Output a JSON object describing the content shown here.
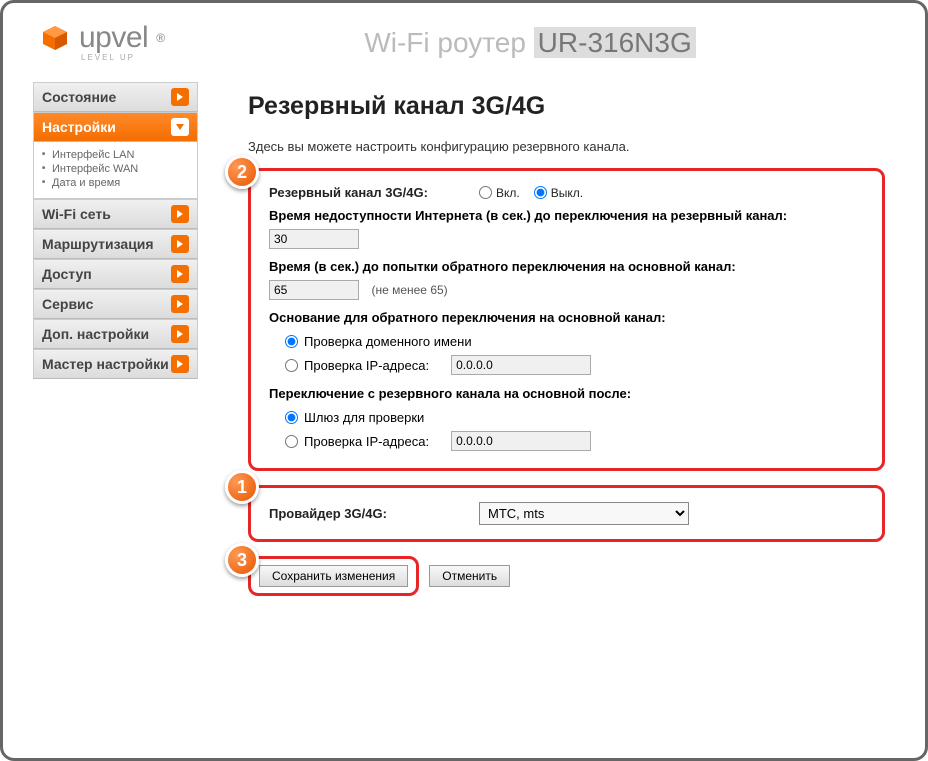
{
  "brand": {
    "name": "upvel",
    "tagline": "LEVEL UP"
  },
  "title": {
    "prefix": "Wi-Fi роутер ",
    "model": "UR-316N3G"
  },
  "nav": {
    "status": "Состояние",
    "settings": "Настройки",
    "sub": {
      "lan": "Интерфейс LAN",
      "wan": "Интерфейс WAN",
      "time": "Дата и время"
    },
    "wifi": "Wi-Fi сеть",
    "routing": "Маршрутизация",
    "access": "Доступ",
    "service": "Сервис",
    "advanced": "Доп. настройки",
    "wizard": "Мастер настройки"
  },
  "page": {
    "heading": "Резервный канал 3G/4G",
    "description": "Здесь вы можете настроить конфигурацию резервного канала.",
    "lbl_backup": "Резервный канал 3G/4G:",
    "on": "Вкл.",
    "off": "Выкл.",
    "lbl_fail_time": "Время недоступности Интернета (в сек.) до переключения на резервный канал:",
    "val_fail_time": "30",
    "lbl_retry_time": "Время (в сек.) до попытки обратного переключения на основной канал:",
    "val_retry_time": "65",
    "retry_hint": "(не менее 65)",
    "lbl_basis": "Основание для обратного переключения на основной канал:",
    "basis_domain": "Проверка доменного имени",
    "basis_ip": "Проверка IP-адреса:",
    "basis_ip_val": "0.0.0.0",
    "lbl_switch_after": "Переключение с резервного канала на основной после:",
    "switch_gw": "Шлюз для проверки",
    "switch_ip": "Проверка IP-адреса:",
    "switch_ip_val": "0.0.0.0",
    "lbl_provider": "Провайдер 3G/4G:",
    "provider_value": "МТС, mts",
    "btn_save": "Сохранить изменения",
    "btn_cancel": "Отменить"
  },
  "badges": {
    "b1": "1",
    "b2": "2",
    "b3": "3"
  }
}
